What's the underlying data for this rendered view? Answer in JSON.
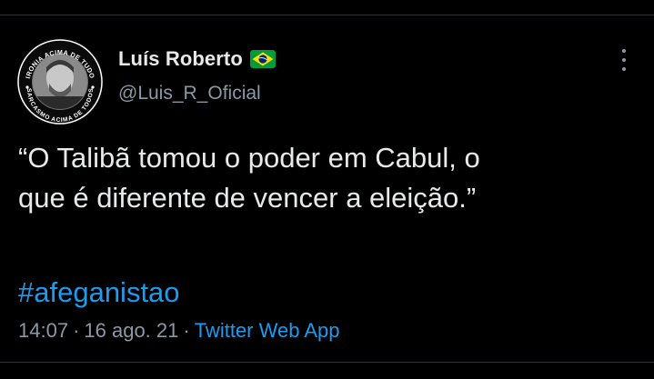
{
  "tweet": {
    "author": {
      "display_name": "Luís Roberto",
      "handle": "@Luis_R_Oficial",
      "avatar_top_text": "IRONIA ACIMA DE TUDO",
      "avatar_bottom_text": "SARCASMO ACIMA DE TODOS",
      "flag": "flag-brazil-icon"
    },
    "text_line_1": "“O Talibã tomou o poder em Cabul, o",
    "text_line_2": "que é diferente de vencer a eleição.”",
    "hashtag": "#afeganistao",
    "time": "14:07",
    "separator": "·",
    "date": "16 ago. 21",
    "source": "Twitter Web App"
  },
  "colors": {
    "background": "#000000",
    "text": "#e7e9ea",
    "secondary": "#8b98a5",
    "accent": "#1d9bf0"
  }
}
